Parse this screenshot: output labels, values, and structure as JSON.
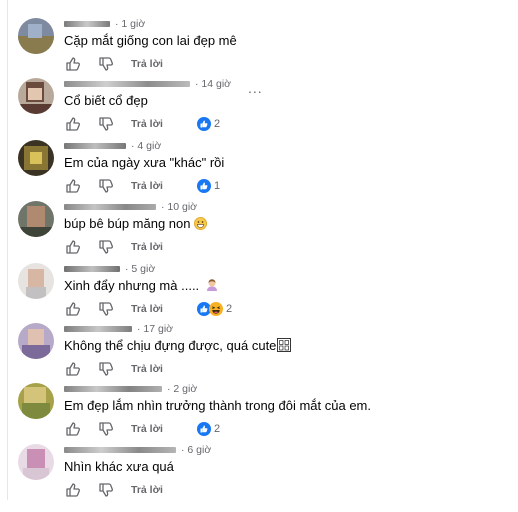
{
  "colors": {
    "text": "#050505",
    "meta": "#65676b",
    "like_blue": "#1877f2",
    "icon_gray": "#65676b"
  },
  "comments": [
    {
      "time": "· 1 giờ",
      "text": "Cặp mắt giống con lai đẹp mê",
      "reply": "Trả lời",
      "reaction_count": "",
      "reactions": []
    },
    {
      "time": "· 14 giờ",
      "text": "Cổ biết cổ đẹp",
      "reply": "Trả lời",
      "reaction_count": "2",
      "reactions": [
        "like"
      ],
      "more": "..."
    },
    {
      "time": "· 4 giờ",
      "text": "Em của ngày xưa \"khác\" rồi",
      "reply": "Trả lời",
      "reaction_count": "1",
      "reactions": [
        "like"
      ]
    },
    {
      "time": "· 10 giờ",
      "text": "búp bê búp măng non",
      "reply": "Trả lời",
      "reaction_count": "",
      "reactions": [],
      "emoji": "grin-emoji"
    },
    {
      "time": "· 5 giờ",
      "text": "Xinh đẩy nhưng mà .....",
      "reply": "Trả lời",
      "reaction_count": "2",
      "reactions": [
        "like",
        "haha"
      ],
      "emoji": "person-emoji"
    },
    {
      "time": "· 17 giờ",
      "text": "Không thể chịu đựng được, quá cute",
      "reply": "Trả lời",
      "reaction_count": "",
      "reactions": [],
      "emoji": "tofu-glyph"
    },
    {
      "time": "· 2 giờ",
      "text": "Em đẹp lắm nhìn trưởng thành trong đôi mắt của em.",
      "reply": "Trả lời",
      "reaction_count": "2",
      "reactions": [
        "like"
      ]
    },
    {
      "time": "· 6 giờ",
      "text": "Nhìn khác xưa quá",
      "reply": "Trả lời",
      "reaction_count": "",
      "reactions": []
    }
  ],
  "icons": {
    "like": "thumbs-up-icon",
    "dislike": "thumbs-down-icon"
  }
}
